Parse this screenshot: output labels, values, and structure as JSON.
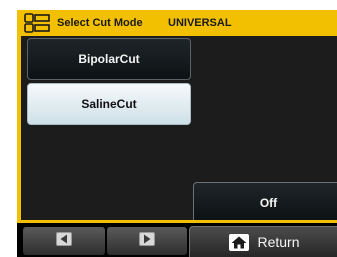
{
  "header": {
    "title": "Select Cut Mode",
    "mode": "UNIVERSAL",
    "icon": "mode-select-icon"
  },
  "modes": [
    {
      "label": "BipolarCut",
      "selected": false
    },
    {
      "label": "SalineCut",
      "selected": true
    }
  ],
  "off_button": {
    "label": "Off"
  },
  "footer": {
    "prev_icon": "arrow-left-icon",
    "next_icon": "arrow-right-icon",
    "return_label": "Return",
    "return_icon": "home-icon"
  },
  "colors": {
    "accent": "#f2c000",
    "background": "#1c1c1c",
    "selected_button": "#dce9ef"
  }
}
